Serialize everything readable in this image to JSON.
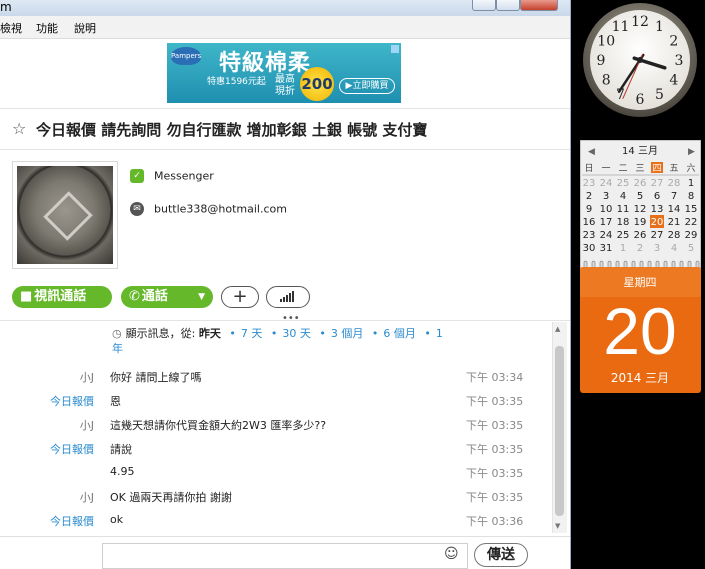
{
  "window": {
    "title_fragment": "m"
  },
  "menu": [
    "檢視",
    "功能",
    "說明"
  ],
  "ad": {
    "brand": "Pampers",
    "headline": "特級棉柔",
    "offer": "特惠1596元起",
    "badge_text": "最高現折",
    "badge_value": "200",
    "cta": "▶立即購買"
  },
  "conversation": {
    "title": "今日報價 請先詢問 勿自行匯款 增加彰銀 土銀 帳號 支付寶",
    "messenger_label": "Messenger",
    "email": "buttle338@hotmail.com"
  },
  "actions": {
    "video": "視訊通話",
    "call": "通話",
    "add": "+"
  },
  "history": {
    "prefix": "顯示訊息，從:",
    "current": "昨天",
    "options": [
      "7 天",
      "30 天",
      "3 個月",
      "6 個月",
      "1 年"
    ]
  },
  "messages": [
    {
      "sender": "小J",
      "me": false,
      "text": "你好 請問上線了嗎",
      "time": "下午 03:34"
    },
    {
      "sender": "今日報價",
      "me": true,
      "text": "恩",
      "time": "下午 03:35"
    },
    {
      "sender": "小J",
      "me": false,
      "text": "這幾天想請你代買金額大約2W3 匯率多少??",
      "time": "下午 03:35"
    },
    {
      "sender": "今日報價",
      "me": true,
      "text": "請說",
      "time": "下午 03:35"
    },
    {
      "sender": "",
      "me": true,
      "text": "4.95",
      "time": "下午 03:35"
    },
    {
      "sender": "小J",
      "me": false,
      "text": "OK 過兩天再請你拍 謝謝",
      "time": "下午 03:35"
    },
    {
      "sender": "今日報價",
      "me": true,
      "text": "ok",
      "time": "下午 03:36"
    }
  ],
  "composer": {
    "value": "",
    "send_label": "傳送"
  },
  "clock": {
    "hour": 3,
    "minute": 35,
    "second": 34,
    "numerals": [
      "12",
      "1",
      "2",
      "3",
      "4",
      "5",
      "6",
      "7",
      "8",
      "9",
      "10",
      "11"
    ]
  },
  "calendar": {
    "header": "14 三月",
    "weekdays": [
      "日",
      "一",
      "二",
      "三",
      "四",
      "五",
      "六"
    ],
    "weeks": [
      [
        "23",
        "24",
        "25",
        "26",
        "27",
        "28",
        "1"
      ],
      [
        "2",
        "3",
        "4",
        "5",
        "6",
        "7",
        "8"
      ],
      [
        "9",
        "10",
        "11",
        "12",
        "13",
        "14",
        "15"
      ],
      [
        "16",
        "17",
        "18",
        "19",
        "20",
        "21",
        "22"
      ],
      [
        "23",
        "24",
        "25",
        "26",
        "27",
        "28",
        "29"
      ],
      [
        "30",
        "31",
        "1",
        "2",
        "3",
        "4",
        "5"
      ]
    ],
    "today": "20",
    "today_weekday": "星期四",
    "today_month": "2014 三月",
    "accent": "#e8701a"
  }
}
